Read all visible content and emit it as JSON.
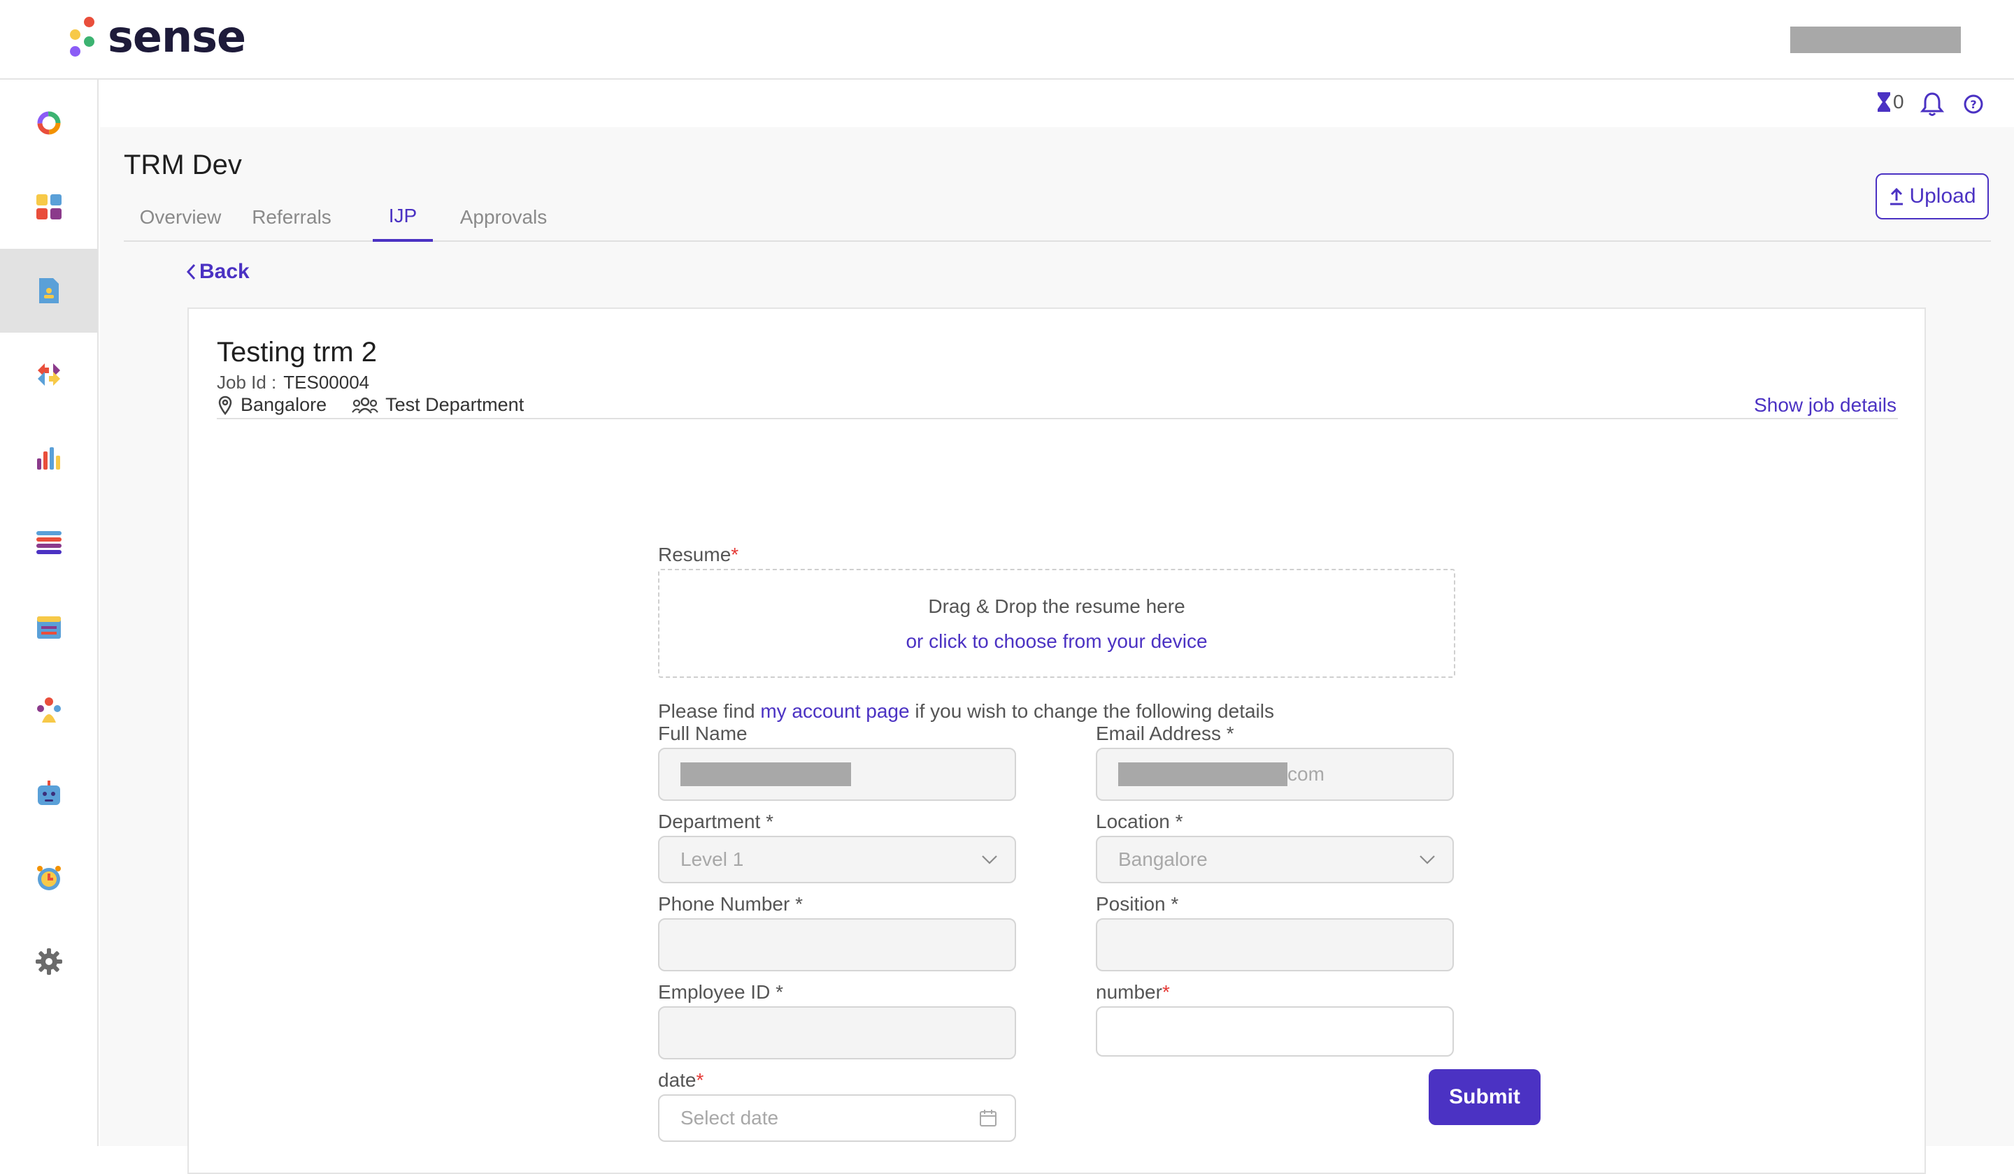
{
  "app": {
    "brand": "sense",
    "brand_colors": {
      "primary": "#4b32c3",
      "dot_orange": "#f39200",
      "dot_red": "#e94e3b",
      "dot_yellow": "#f7c948",
      "dot_green": "#3cb371",
      "dot_purple": "#8b5cf6"
    }
  },
  "sidebar": {
    "items": [
      {
        "name": "home-ring-icon",
        "active": false
      },
      {
        "name": "dashboard-grid-icon",
        "active": false
      },
      {
        "name": "referral-document-icon",
        "active": true
      },
      {
        "name": "arrows-exchange-icon",
        "active": false
      },
      {
        "name": "bar-chart-icon",
        "active": false
      },
      {
        "name": "list-icon",
        "active": false
      },
      {
        "name": "calendar-icon",
        "active": false
      },
      {
        "name": "team-icon",
        "active": false
      },
      {
        "name": "chatbot-icon",
        "active": false
      },
      {
        "name": "alarm-clock-icon",
        "active": false
      },
      {
        "name": "gear-icon",
        "active": false
      }
    ]
  },
  "utility": {
    "credits_count": "0"
  },
  "page": {
    "title": "TRM Dev",
    "tabs": [
      {
        "label": "Overview",
        "active": false
      },
      {
        "label": "Referrals",
        "active": false
      },
      {
        "label": "IJP",
        "active": true
      },
      {
        "label": "Approvals",
        "active": false
      }
    ],
    "upload_label": "Upload",
    "back_label": "Back"
  },
  "job": {
    "title": "Testing trm 2",
    "id_label": "Job Id :",
    "id_value": "TES00004",
    "location": "Bangalore",
    "department": "Test Department",
    "show_details_label": "Show job details"
  },
  "form": {
    "resume_label": "Resume",
    "resume_required": "*",
    "dropzone_line1": "Drag & Drop the resume here",
    "dropzone_line2": "or click to choose from your device",
    "note_prefix": "Please find ",
    "note_link": "my account page",
    "note_suffix": " if you wish to change the following details",
    "full_name_label": "Full Name",
    "email_label": "Email Address *",
    "email_suffix": "com",
    "department_label": "Department *",
    "department_value": "Level 1",
    "location_label": "Location *",
    "location_value": "Bangalore",
    "phone_label": "Phone Number *",
    "position_label": "Position *",
    "employee_id_label": "Employee ID *",
    "number_label": "number",
    "number_required": "*",
    "date_label": "date",
    "date_required": "*",
    "date_placeholder": "Select date",
    "submit_label": "Submit"
  }
}
